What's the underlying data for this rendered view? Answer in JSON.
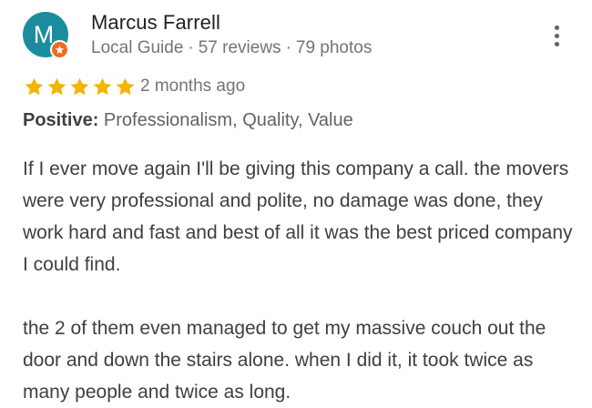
{
  "reviewer": {
    "initial": "M",
    "name": "Marcus Farrell",
    "badge": "Local Guide",
    "reviews": "57 reviews",
    "photos": "79 photos",
    "avatar_color": "#1b8c9e",
    "badge_color": "#f26b1d"
  },
  "rating": {
    "stars": 5,
    "max": 5,
    "star_color": "#f4b400",
    "date": "2 months ago"
  },
  "positive": {
    "label": "Positive:",
    "values": "Professionalism, Quality, Value"
  },
  "review_text": {
    "paragraph1": "If I ever move again I'll be giving this company a call. the movers were very professional and polite, no damage was done, they work hard and fast and best of all it was the best priced company I could find.",
    "paragraph2": "the 2 of them even managed to get my massive couch out the door and down the stairs alone. when I did it, it took twice as many people and twice as long."
  },
  "icons": {
    "more": "more-vert-icon",
    "star": "star-icon",
    "guide": "local-guide-star-icon"
  }
}
